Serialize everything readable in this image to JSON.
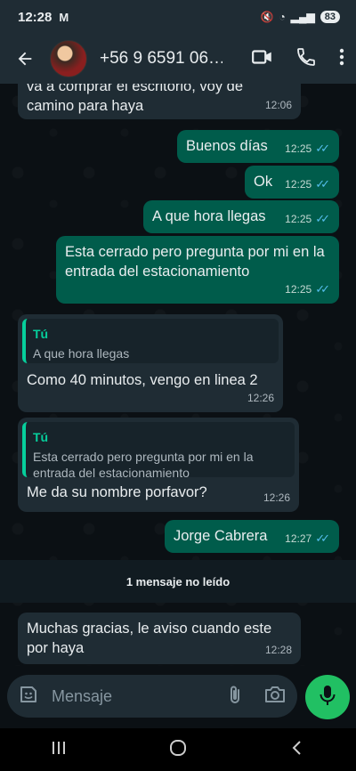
{
  "status": {
    "time": "12:28",
    "battery": "83"
  },
  "header": {
    "contact": "+56 9 6591 06…"
  },
  "messages": [
    {
      "text": "va a comprar el escritorio, voy de camino para haya",
      "time": "12:06"
    },
    {
      "text": "Buenos días",
      "time": "12:25"
    },
    {
      "text": "Ok",
      "time": "12:25"
    },
    {
      "text": "A que hora llegas",
      "time": "12:25"
    },
    {
      "text": "Esta cerrado pero pregunta por mi en la entrada del estacionamiento",
      "time": "12:25"
    },
    {
      "quote_author": "Tú",
      "quote_text": "A que hora llegas",
      "text": "Como 40 minutos, vengo en linea 2",
      "time": "12:26"
    },
    {
      "quote_author": "Tú",
      "quote_text": "Esta cerrado pero pregunta por mi en la entrada del estacionamiento",
      "text": "Me da su nombre porfavor?",
      "time": "12:26"
    },
    {
      "text": "Jorge Cabrera",
      "time": "12:27"
    },
    {
      "text": "Muchas gracias, le aviso cuando este por haya",
      "time": "12:28"
    }
  ],
  "unread_label": "1 mensaje no leído",
  "input": {
    "placeholder": "Mensaje"
  }
}
